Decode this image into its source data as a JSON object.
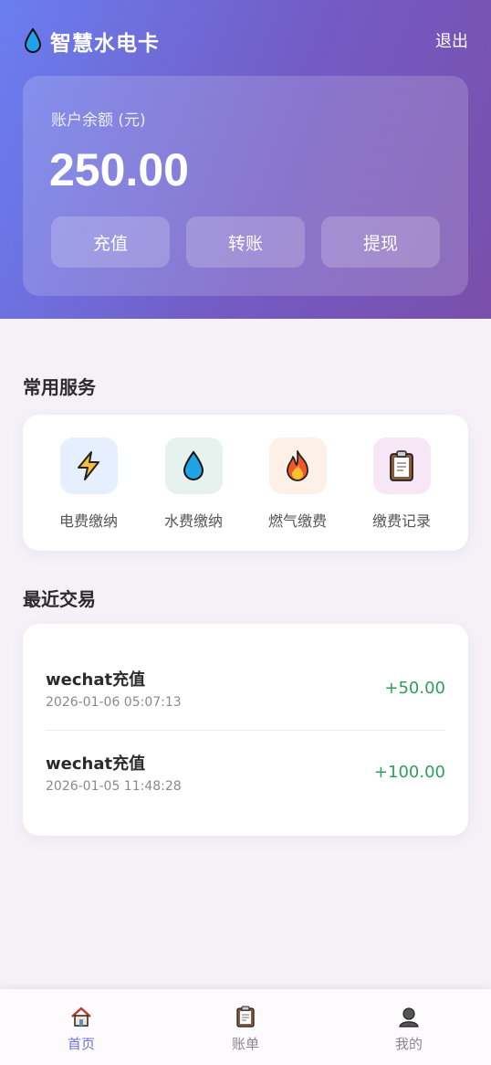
{
  "header": {
    "brand_icon": "water-drop-icon",
    "title": "智慧水电卡",
    "logout_label": "退出"
  },
  "balance": {
    "label": "账户余额 (元)",
    "amount": "250.00",
    "actions": [
      "充值",
      "转账",
      "提现"
    ]
  },
  "services": {
    "title": "常用服务",
    "items": [
      {
        "label": "电费缴纳",
        "icon": "lightning-icon",
        "bg": "#e6effd"
      },
      {
        "label": "水费缴纳",
        "icon": "water-drop-icon",
        "bg": "#e7f1ee"
      },
      {
        "label": "燃气缴费",
        "icon": "flame-icon",
        "bg": "#fdf0e6"
      },
      {
        "label": "缴费记录",
        "icon": "clipboard-icon",
        "bg": "#f6e6f6"
      }
    ]
  },
  "transactions": {
    "title": "最近交易",
    "items": [
      {
        "title": "wechat充值",
        "time": "2026-01-06 05:07:13",
        "amount": "+50.00"
      },
      {
        "title": "wechat充值",
        "time": "2026-01-05 11:48:28",
        "amount": "+100.00"
      }
    ]
  },
  "tabbar": {
    "items": [
      {
        "label": "首页",
        "icon": "home-icon",
        "active": true
      },
      {
        "label": "账单",
        "icon": "clipboard-icon",
        "active": false
      },
      {
        "label": "我的",
        "icon": "user-icon",
        "active": false
      }
    ]
  },
  "colors": {
    "header_gradient_start": "#6a7ef0",
    "header_gradient_end": "#7a4fab",
    "amount_positive": "#2e9e5b",
    "tab_active": "#6b74d6"
  }
}
